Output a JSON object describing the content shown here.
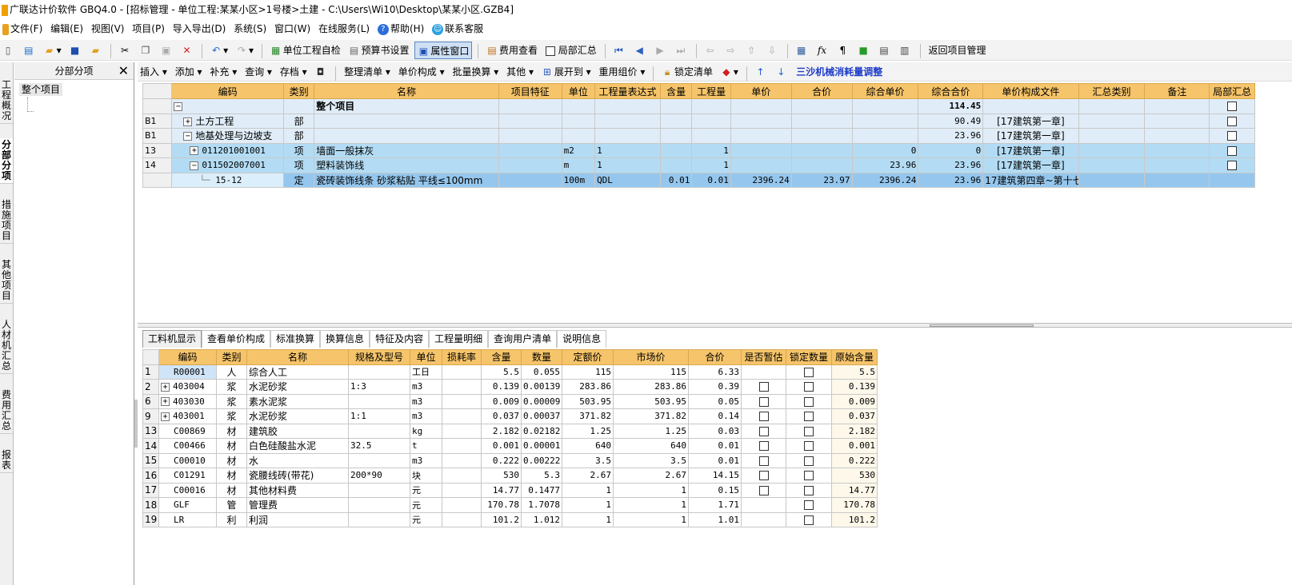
{
  "window": {
    "title": "广联达计价软件 GBQ4.0 - [招标管理 - 单位工程:某某小区>1号楼>土建 - C:\\Users\\Wi10\\Desktop\\某某小区.GZB4]"
  },
  "menu": [
    "文件(F)",
    "编辑(E)",
    "视图(V)",
    "项目(P)",
    "导入导出(D)",
    "系统(S)",
    "窗口(W)",
    "在线服务(L)",
    "帮助(H)",
    "联系客服"
  ],
  "toolbar": {
    "self_check": "单位工程自检",
    "budget_settings": "预算书设置",
    "property_window": "属性窗口",
    "fee_view": "费用查看",
    "partial_summary": "局部汇总",
    "return_project": "返回项目管理"
  },
  "left_tabs": [
    "工程概况",
    "分部分项",
    "措施项目",
    "其他项目",
    "人材机汇总",
    "费用汇总",
    "报表"
  ],
  "left_panel": {
    "title": "分部分项",
    "tree_root": "整个项目"
  },
  "toolbar2": {
    "insert": "插入",
    "add": "添加",
    "supplement": "补充",
    "query": "查询",
    "save": "存档",
    "organize": "整理清单",
    "price_comp": "单价构成",
    "batch_convert": "批量换算",
    "other": "其他",
    "expand_to": "展开到",
    "reuse": "重用组价",
    "lock": "锁定清单",
    "link": "三沙机械消耗量调整"
  },
  "top_grid": {
    "headers": [
      "编码",
      "类别",
      "名称",
      "项目特征",
      "单位",
      "工程量表达式",
      "含量",
      "工程量",
      "单价",
      "合价",
      "综合单价",
      "综合合价",
      "单价构成文件",
      "汇总类别",
      "备注",
      "局部汇总"
    ],
    "rows": [
      {
        "idx": "",
        "code": "",
        "type": "",
        "name": "整个项目",
        "feature": "",
        "unit": "",
        "expr": "",
        "content": "",
        "qty": "",
        "price": "",
        "total": "",
        "comp_price": "",
        "comp_total": "114.45",
        "file": "",
        "cat": "",
        "note": ""
      },
      {
        "idx": "B1",
        "code": "土方工程",
        "type": "部",
        "name": "",
        "feature": "",
        "unit": "",
        "expr": "",
        "content": "",
        "qty": "",
        "price": "",
        "total": "",
        "comp_price": "",
        "comp_total": "90.49",
        "file": "[17建筑第一章]",
        "cat": "",
        "note": ""
      },
      {
        "idx": "B1",
        "code": "地基处理与边坡支",
        "type": "部",
        "name": "",
        "feature": "",
        "unit": "",
        "expr": "",
        "content": "",
        "qty": "",
        "price": "",
        "total": "",
        "comp_price": "",
        "comp_total": "23.96",
        "file": "[17建筑第一章]",
        "cat": "",
        "note": ""
      },
      {
        "idx": "13",
        "code": "011201001001",
        "type": "项",
        "name": "墙面一般抹灰",
        "feature": "",
        "unit": "m2",
        "expr": "1",
        "content": "",
        "qty": "1",
        "price": "",
        "total": "",
        "comp_price": "0",
        "comp_total": "0",
        "file": "[17建筑第一章]",
        "cat": "",
        "note": ""
      },
      {
        "idx": "14",
        "code": "011502007001",
        "type": "项",
        "name": "塑料装饰线",
        "feature": "",
        "unit": "m",
        "expr": "1",
        "content": "",
        "qty": "1",
        "price": "",
        "total": "",
        "comp_price": "23.96",
        "comp_total": "23.96",
        "file": "[17建筑第一章]",
        "cat": "",
        "note": ""
      },
      {
        "idx": "",
        "code": "15-12",
        "type": "定",
        "name": "瓷砖装饰线条 砂浆粘贴 平线≤100mm",
        "feature": "",
        "unit": "100m",
        "expr": "QDL",
        "content": "0.01",
        "qty": "0.01",
        "price": "2396.24",
        "total": "23.97",
        "comp_price": "2396.24",
        "comp_total": "23.96",
        "file": "17建筑第四章~第十七",
        "cat": "",
        "note": ""
      }
    ]
  },
  "bottom_tabs": [
    "工料机显示",
    "查看单价构成",
    "标准换算",
    "换算信息",
    "特征及内容",
    "工程量明细",
    "查询用户清单",
    "说明信息"
  ],
  "bottom_grid": {
    "headers": [
      "编码",
      "类别",
      "名称",
      "规格及型号",
      "单位",
      "损耗率",
      "含量",
      "数量",
      "定额价",
      "市场价",
      "合价",
      "是否暂估",
      "锁定数量",
      "原始含量"
    ],
    "rows": [
      {
        "idx": "1",
        "code": "R00001",
        "type": "人",
        "name": "综合人工",
        "spec": "",
        "unit": "工日",
        "loss": "",
        "content": "5.5",
        "qty": "0.055",
        "base": "115",
        "market": "115",
        "total": "6.33",
        "est": false,
        "orig": "5.5",
        "expand": false
      },
      {
        "idx": "2",
        "code": "403004",
        "type": "浆",
        "name": "水泥砂浆",
        "spec": "1:3",
        "unit": "m3",
        "loss": "",
        "content": "0.139",
        "qty": "0.00139",
        "base": "283.86",
        "market": "283.86",
        "total": "0.39",
        "est": true,
        "orig": "0.139",
        "expand": true
      },
      {
        "idx": "6",
        "code": "403030",
        "type": "浆",
        "name": "素水泥浆",
        "spec": "",
        "unit": "m3",
        "loss": "",
        "content": "0.009",
        "qty": "0.00009",
        "base": "503.95",
        "market": "503.95",
        "total": "0.05",
        "est": true,
        "orig": "0.009",
        "expand": true
      },
      {
        "idx": "9",
        "code": "403001",
        "type": "浆",
        "name": "水泥砂浆",
        "spec": "1:1",
        "unit": "m3",
        "loss": "",
        "content": "0.037",
        "qty": "0.00037",
        "base": "371.82",
        "market": "371.82",
        "total": "0.14",
        "est": true,
        "orig": "0.037",
        "expand": true
      },
      {
        "idx": "13",
        "code": "C00869",
        "type": "材",
        "name": "建筑胶",
        "spec": "",
        "unit": "kg",
        "loss": "",
        "content": "2.182",
        "qty": "0.02182",
        "base": "1.25",
        "market": "1.25",
        "total": "0.03",
        "est": true,
        "orig": "2.182",
        "expand": false
      },
      {
        "idx": "14",
        "code": "C00466",
        "type": "材",
        "name": "白色硅酸盐水泥",
        "spec": "32.5",
        "unit": "t",
        "loss": "",
        "content": "0.001",
        "qty": "0.00001",
        "base": "640",
        "market": "640",
        "total": "0.01",
        "est": true,
        "orig": "0.001",
        "expand": false
      },
      {
        "idx": "15",
        "code": "C00010",
        "type": "材",
        "name": "水",
        "spec": "",
        "unit": "m3",
        "loss": "",
        "content": "0.222",
        "qty": "0.00222",
        "base": "3.5",
        "market": "3.5",
        "total": "0.01",
        "est": true,
        "orig": "0.222",
        "expand": false
      },
      {
        "idx": "16",
        "code": "C01291",
        "type": "材",
        "name": "瓷腰线砖(带花)",
        "spec": "200*90",
        "unit": "块",
        "loss": "",
        "content": "530",
        "qty": "5.3",
        "base": "2.67",
        "market": "2.67",
        "total": "14.15",
        "est": true,
        "orig": "530",
        "expand": false
      },
      {
        "idx": "17",
        "code": "C00016",
        "type": "材",
        "name": "其他材料费",
        "spec": "",
        "unit": "元",
        "loss": "",
        "content": "14.77",
        "qty": "0.1477",
        "base": "1",
        "market": "1",
        "total": "0.15",
        "est": true,
        "orig": "14.77",
        "expand": false
      },
      {
        "idx": "18",
        "code": "GLF",
        "type": "管",
        "name": "管理费",
        "spec": "",
        "unit": "元",
        "loss": "",
        "content": "170.78",
        "qty": "1.7078",
        "base": "1",
        "market": "1",
        "total": "1.71",
        "est": false,
        "orig": "170.78",
        "expand": false
      },
      {
        "idx": "19",
        "code": "LR",
        "type": "利",
        "name": "利润",
        "spec": "",
        "unit": "元",
        "loss": "",
        "content": "101.2",
        "qty": "1.012",
        "base": "1",
        "market": "1",
        "total": "1.01",
        "est": false,
        "orig": "101.2",
        "expand": false
      }
    ]
  }
}
